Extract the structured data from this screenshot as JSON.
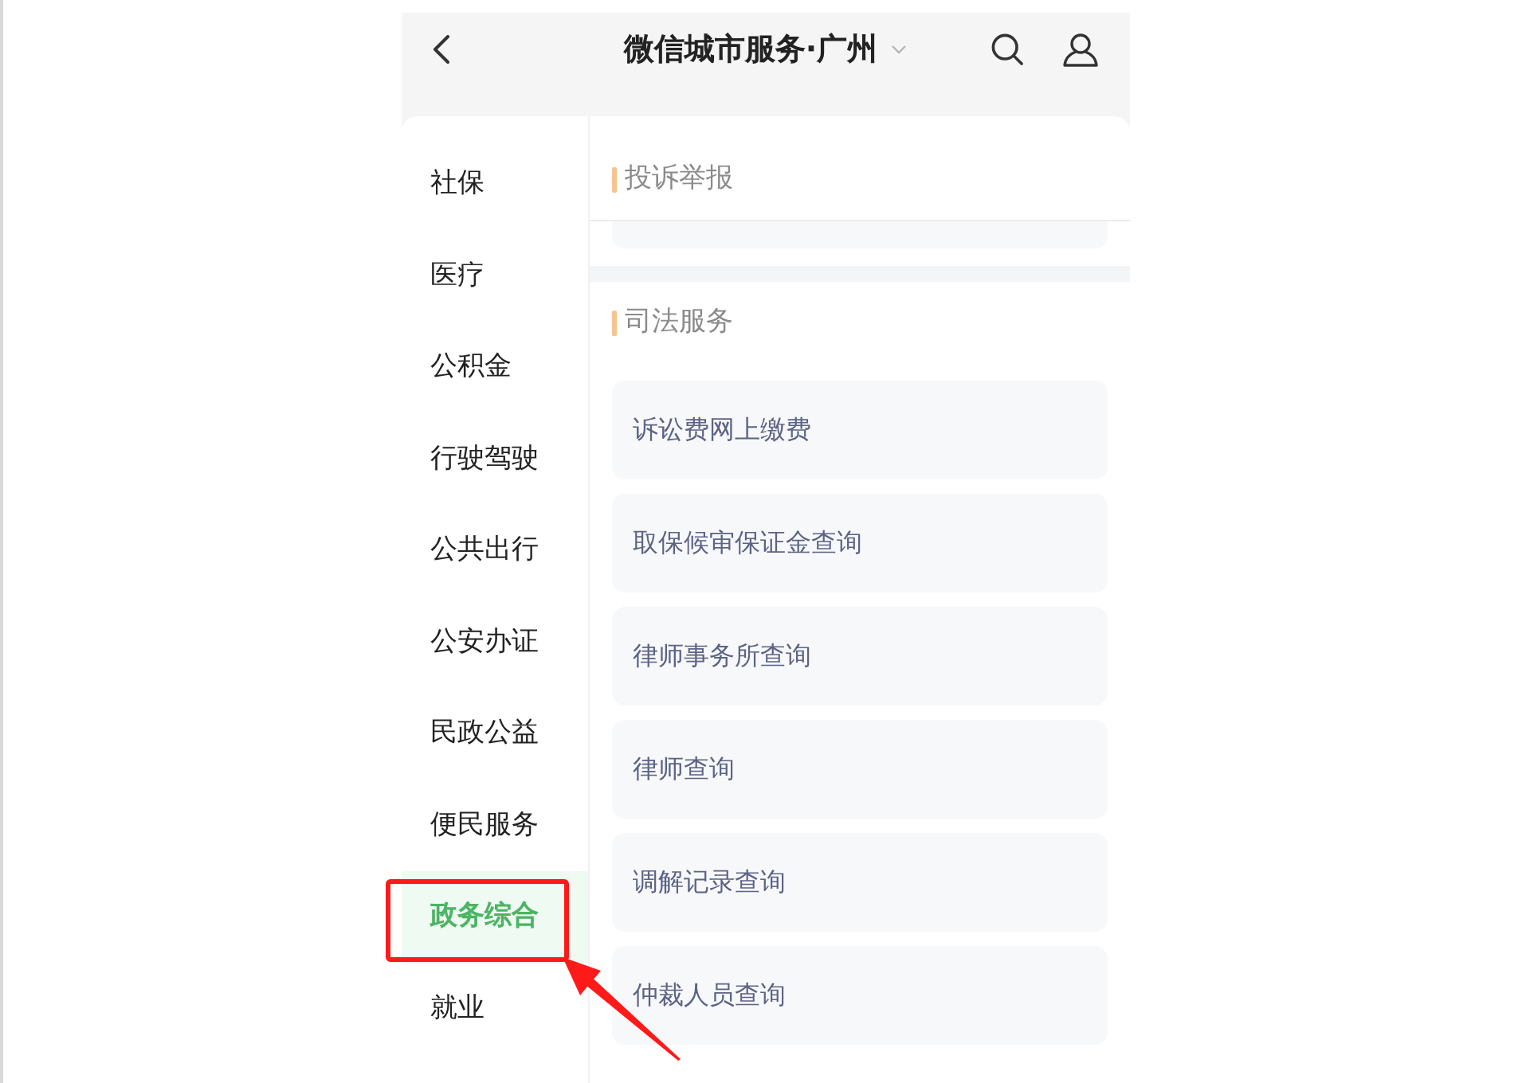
{
  "header": {
    "title": "微信城市服务·广州"
  },
  "sidebar": {
    "items": [
      {
        "label": "社保",
        "selected": false,
        "annotated": false
      },
      {
        "label": "医疗",
        "selected": false,
        "annotated": false
      },
      {
        "label": "公积金",
        "selected": false,
        "annotated": false
      },
      {
        "label": "行驶驾驶",
        "selected": false,
        "annotated": false
      },
      {
        "label": "公共出行",
        "selected": false,
        "annotated": false
      },
      {
        "label": "公安办证",
        "selected": false,
        "annotated": false
      },
      {
        "label": "民政公益",
        "selected": false,
        "annotated": false
      },
      {
        "label": "便民服务",
        "selected": false,
        "annotated": false
      },
      {
        "label": "政务综合",
        "selected": true,
        "annotated": true
      },
      {
        "label": "就业",
        "selected": false,
        "annotated": false
      }
    ]
  },
  "sections": [
    {
      "kind": "pinned",
      "title": "投诉举报"
    },
    {
      "kind": "list",
      "title": "司法服务",
      "items": [
        {
          "label": "诉讼费网上缴费"
        },
        {
          "label": "取保候审保证金查询"
        },
        {
          "label": "律师事务所查询"
        },
        {
          "label": "律师查询"
        },
        {
          "label": "调解记录查询"
        },
        {
          "label": "仲裁人员查询"
        }
      ]
    }
  ]
}
